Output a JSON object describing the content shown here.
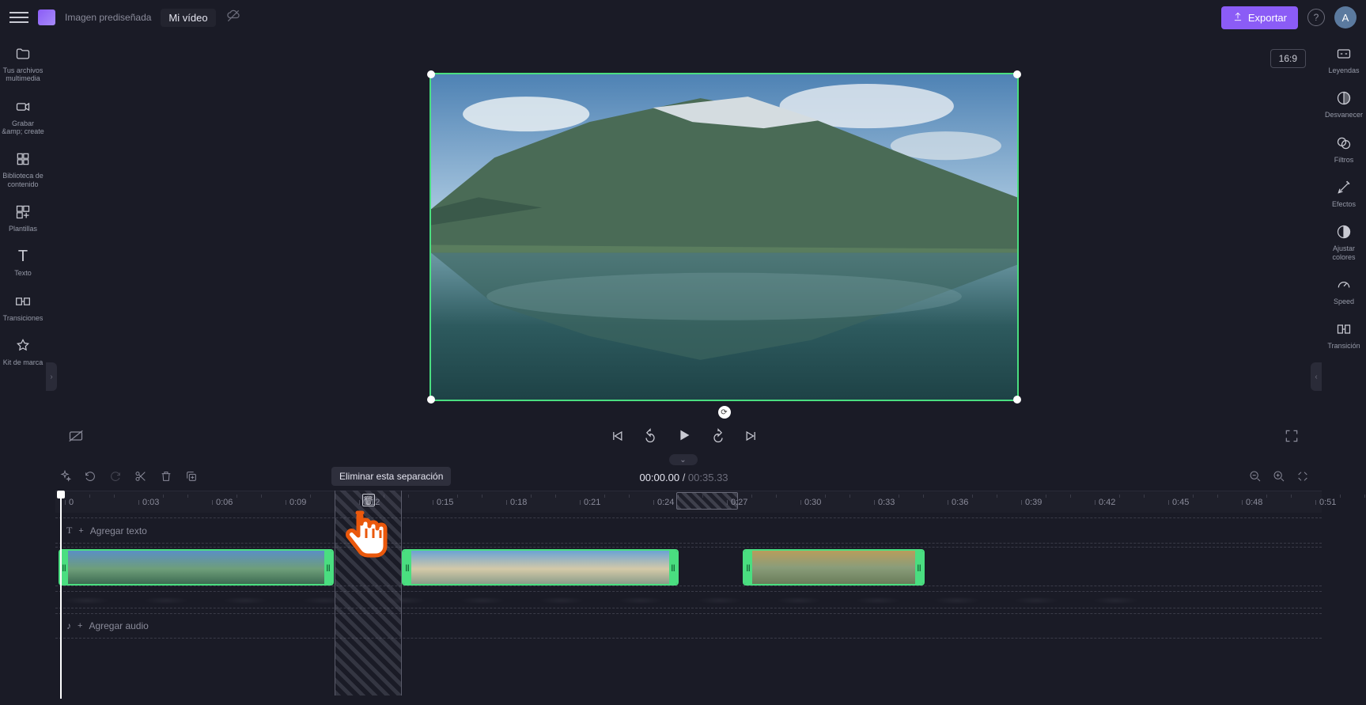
{
  "topbar": {
    "preset_label": "Imagen prediseñada",
    "project_name": "Mi vídeo",
    "export_label": "Exportar",
    "avatar_initial": "A"
  },
  "left_sidebar": {
    "items": [
      {
        "label": "Tus archivos multimedia"
      },
      {
        "label": "Grabar &amp;\ncreate"
      },
      {
        "label": "Biblioteca de contenido"
      },
      {
        "label": "Plantillas"
      },
      {
        "label": "Texto"
      },
      {
        "label": "Transiciones"
      },
      {
        "label": "Kit de marca"
      }
    ]
  },
  "right_sidebar": {
    "items": [
      {
        "label": "Leyendas"
      },
      {
        "label": "Desvanecer"
      },
      {
        "label": "Filtros"
      },
      {
        "label": "Efectos"
      },
      {
        "label": "Ajustar colores"
      },
      {
        "label": "Speed"
      },
      {
        "label": "Transición"
      }
    ]
  },
  "preview": {
    "aspect": "16:9"
  },
  "playback": {
    "current_time": "00:00.00",
    "duration": "00:35.33"
  },
  "tooltip": {
    "text": "Eliminar esta separación"
  },
  "ruler": {
    "labels": [
      "0",
      "0:03",
      "0:06",
      "0:09",
      "0:12",
      "0:15",
      "0:18",
      "0:21",
      "0:24",
      "0:27",
      "0:30",
      "0:33",
      "0:36",
      "0:39",
      "0:42",
      "0:45",
      "0:48",
      "0:51"
    ]
  },
  "timeline": {
    "text_row": {
      "icon": "T",
      "add": "+",
      "label": "Agregar texto"
    },
    "audio_row": {
      "add": "+",
      "label": "Agregar audio"
    }
  }
}
